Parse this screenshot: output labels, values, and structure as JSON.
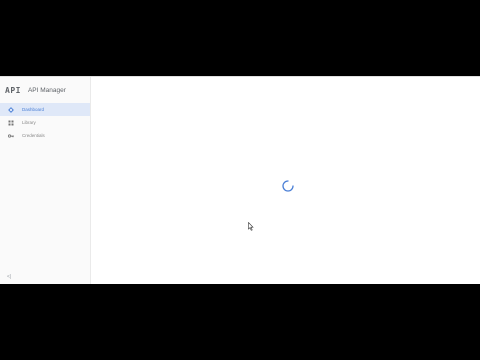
{
  "brand": {
    "logo": "API",
    "title": "API Manager"
  },
  "sidebar": {
    "items": [
      {
        "label": "Dashboard",
        "icon": "dashboard-icon",
        "active": true
      },
      {
        "label": "Library",
        "icon": "library-icon",
        "active": false
      },
      {
        "label": "Credentials",
        "icon": "key-icon",
        "active": false
      }
    ],
    "collapse_label": "<|"
  },
  "main": {
    "state": "loading"
  },
  "colors": {
    "accent": "#4a7fd6",
    "active_bg": "#dfe8f8",
    "sidebar_bg": "#fafafa"
  }
}
